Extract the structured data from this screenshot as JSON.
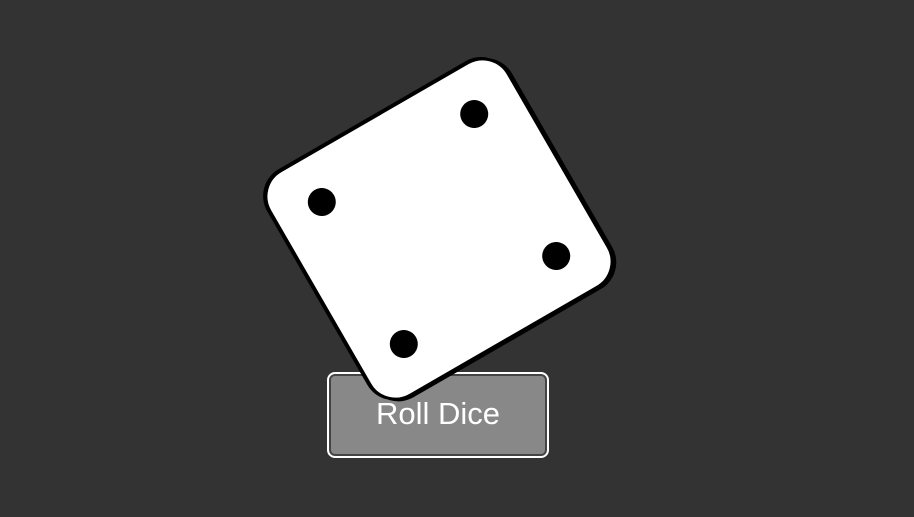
{
  "game": {
    "die": {
      "face_value": 4,
      "color": "#ffffff",
      "pip_color": "#000000"
    },
    "roll_button": {
      "label": "Roll Dice",
      "color": "#888888",
      "border_color": "#ffffff"
    },
    "background_color": "#333333"
  }
}
